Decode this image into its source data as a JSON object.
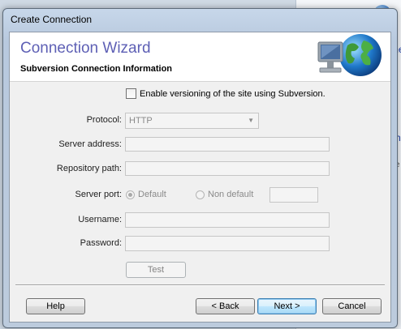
{
  "window": {
    "title": "Create Connection"
  },
  "banner": {
    "title": "Connection Wizard",
    "subtitle": "Subversion Connection Information"
  },
  "form": {
    "enable_versioning_label": "Enable versioning of the site using Subversion.",
    "enable_versioning_checked": false,
    "protocol_label": "Protocol:",
    "protocol_value": "HTTP",
    "server_address_label": "Server address:",
    "server_address_value": "",
    "repository_path_label": "Repository path:",
    "repository_path_value": "",
    "server_port_label": "Server port:",
    "port_option_default": "Default",
    "port_option_non_default": "Non default",
    "port_selected": "Default",
    "port_value": "",
    "username_label": "Username:",
    "username_value": "",
    "password_label": "Password:",
    "password_value": "",
    "test_button": "Test"
  },
  "footer": {
    "help_button": "Help",
    "back_button": "< Back",
    "next_button": "Next >",
    "cancel_button": "Cancel"
  },
  "background": {
    "fragment_1": "me",
    "fragment_2": "ith",
    "fragment_3": "e"
  },
  "icons": {
    "banner": "computer-globe-icon",
    "dropdown": "chevron-down-icon",
    "background_orb": "globe-orb-icon"
  },
  "colors": {
    "wizard_title": "#5e60b5",
    "window_frame": "#c7d7ea",
    "client_bg": "#f0f0f0"
  }
}
